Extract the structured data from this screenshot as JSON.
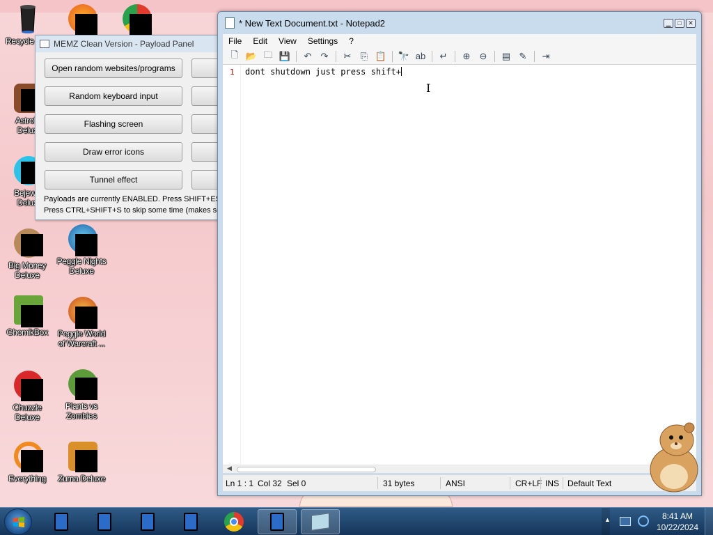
{
  "desktop": {
    "icons": [
      {
        "label": "Recycle"
      },
      {
        "label": "AstroP\nDelux"
      },
      {
        "label": "Bejewe\nDelux"
      },
      {
        "label": "Big Money\nDeluxe"
      },
      {
        "label": "Peggle Nights\nDeluxe"
      },
      {
        "label": "GhomikBox"
      },
      {
        "label": "Peggle World\nof Warcraft ..."
      },
      {
        "label": "Chuzzle\nDeluxe"
      },
      {
        "label": "Plants vs\nZombies"
      },
      {
        "label": "Everything"
      },
      {
        "label": "Zuma Deluxe"
      }
    ]
  },
  "memz": {
    "title": "MEMZ Clean Version - Payload Panel",
    "buttons": [
      "Open random websites/programs",
      "Random keyboard input",
      "Flashing screen",
      "Draw error icons",
      "Tunnel effect"
    ],
    "status_line1": "Payloads are currently ENABLED. Press SHIFT+ESC",
    "status_line2": "Press CTRL+SHIFT+S to skip some time (makes som"
  },
  "notepad": {
    "title": "* New Text Document.txt - Notepad2",
    "menu": [
      "File",
      "Edit",
      "View",
      "Settings",
      "?"
    ],
    "line_number": "1",
    "content": "dont shutdown just press shift+",
    "status": {
      "position": "Ln 1 : 1",
      "column": "Col 32",
      "selection": "Sel 0",
      "size": "31 bytes",
      "encoding": "ANSI",
      "line_endings": "CR+LF",
      "mode": "INS",
      "scheme": "Default Text"
    }
  },
  "taskbar": {
    "time": "8:41 AM",
    "date": "10/22/2024"
  },
  "colors": {
    "taskbar": "#1e4470",
    "line_number": "#cc0000",
    "desktop": "#f6d2d4"
  }
}
